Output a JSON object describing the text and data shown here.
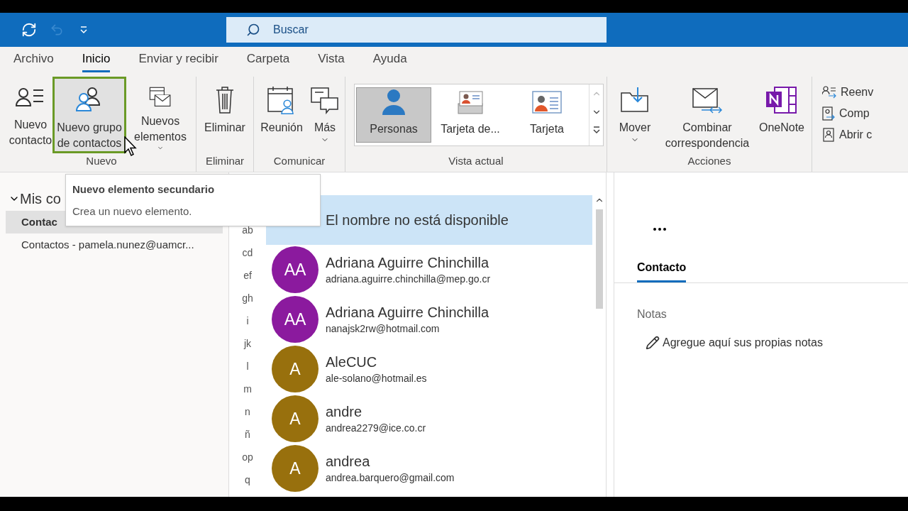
{
  "title_bar": {
    "search": {
      "placeholder": "Buscar"
    }
  },
  "tabs": [
    {
      "label": "Archivo",
      "selected": false
    },
    {
      "label": "Inicio",
      "selected": true
    },
    {
      "label": "Enviar y recibir",
      "selected": false
    },
    {
      "label": "Carpeta",
      "selected": false
    },
    {
      "label": "Vista",
      "selected": false
    },
    {
      "label": "Ayuda",
      "selected": false
    }
  ],
  "ribbon_groups": [
    {
      "label": "Nuevo",
      "buttons": [
        {
          "kind": "new-contact",
          "label": "Nuevo contacto",
          "dropdown": false,
          "highlighted": false
        },
        {
          "kind": "new-group",
          "label": "Nuevo grupo de contactos",
          "dropdown": false,
          "highlighted": true
        },
        {
          "kind": "new-items",
          "label": "Nuevos elementos",
          "dropdown": true,
          "highlighted": false
        }
      ]
    },
    {
      "label": "Eliminar",
      "buttons": [
        {
          "kind": "delete",
          "label": "Eliminar",
          "dropdown": false,
          "highlighted": false
        }
      ]
    },
    {
      "label": "Comunicar",
      "buttons": [
        {
          "kind": "meeting",
          "label": "Reunión",
          "dropdown": false,
          "highlighted": false
        },
        {
          "kind": "more",
          "label": "Más",
          "dropdown": true,
          "highlighted": false
        }
      ]
    },
    {
      "label": "Vista actual",
      "gallery": [
        {
          "kind": "people",
          "label": "Personas",
          "selected": true
        },
        {
          "kind": "business-card",
          "label": "Tarjeta de...",
          "selected": false
        },
        {
          "kind": "card",
          "label": "Tarjeta",
          "selected": false
        }
      ]
    },
    {
      "label": "Acciones",
      "buttons": [
        {
          "kind": "move",
          "label": "Mover",
          "dropdown": true,
          "highlighted": false
        },
        {
          "kind": "mail-merge",
          "label": "Combinar correspondencia",
          "dropdown": false,
          "highlighted": false
        },
        {
          "kind": "onenote",
          "label": "OneNote",
          "dropdown": false,
          "highlighted": false
        }
      ]
    }
  ],
  "ribbon_small_buttons": [
    {
      "kind": "forward",
      "label": "Reenv"
    },
    {
      "kind": "share",
      "label": "Comp"
    },
    {
      "kind": "open",
      "label": "Abrir c"
    }
  ],
  "sidebar": {
    "heading": "Mis co",
    "expanded": true,
    "items": [
      {
        "label": "Contac",
        "selected": true
      },
      {
        "label": "Contactos - pamela.nunez@uamcr...",
        "selected": false
      }
    ]
  },
  "index_letters": [
    "ab",
    "cd",
    "ef",
    "gh",
    "i",
    "jk",
    "l",
    "m",
    "n",
    "ñ",
    "op",
    "q"
  ],
  "contacts": [
    {
      "name": "El nombre no está disponible",
      "selected": true
    },
    {
      "initials": "AA",
      "name": "Adriana Aguirre Chinchilla",
      "email": "adriana.aguirre.chinchilla@mep.go.cr",
      "color": "#8b1a9e",
      "selected": false
    },
    {
      "initials": "AA",
      "name": "Adriana Aguirre Chinchilla",
      "email": "nanajsk2rw@hotmail.com",
      "color": "#8b1a9e",
      "selected": false
    },
    {
      "initials": "A",
      "name": "AleCUC",
      "email": "ale-solano@hotmail.es",
      "color": "#98700d",
      "selected": false
    },
    {
      "initials": "A",
      "name": "andre",
      "email": "andrea2279@ice.co.cr",
      "color": "#98700d",
      "selected": false
    },
    {
      "initials": "A",
      "name": "andrea",
      "email": "andrea.barquero@gmail.com",
      "color": "#98700d",
      "selected": false
    }
  ],
  "reading_pane": {
    "tabs": [
      {
        "label": "Contacto",
        "selected": true
      }
    ],
    "notes_label": "Notas",
    "notes_placeholder": "Agregue aquí sus propias notas"
  },
  "tooltip": {
    "title": "Nuevo elemento secundario",
    "text": "Crea un nuevo elemento."
  }
}
